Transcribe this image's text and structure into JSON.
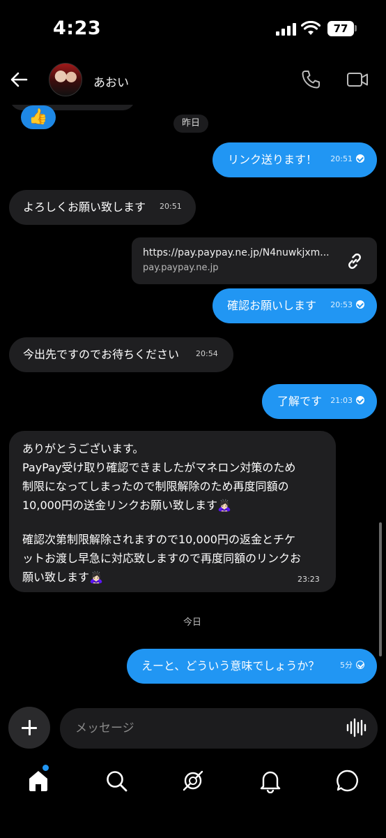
{
  "status_bar": {
    "time": "4:23",
    "battery": "77"
  },
  "header": {
    "back_icon": "back-arrow-icon",
    "contact_name": "あおい",
    "phone_icon": "phone-icon",
    "video_icon": "video-camera-icon"
  },
  "chat": {
    "reaction": "👍",
    "day_yesterday": "昨日",
    "day_today": "今日",
    "messages": [
      {
        "dir": "out",
        "text": "リンク送ります！",
        "time": "20:51",
        "read": true
      },
      {
        "dir": "in",
        "text": "よろしくお願い致します",
        "time": "20:51"
      },
      {
        "dir": "out",
        "type": "link",
        "url": "https://pay.paypay.ne.jp/N4nuwkjxm...",
        "domain": "pay.paypay.ne.jp"
      },
      {
        "dir": "out",
        "text": "確認お願いします",
        "time": "20:53",
        "read": true
      },
      {
        "dir": "in",
        "text": "今出先ですのでお待ちください",
        "time": "20:54"
      },
      {
        "dir": "out",
        "text": "了解です",
        "time": "21:03",
        "read": true
      },
      {
        "dir": "in",
        "lines": [
          "ありがとうございます。",
          "PayPay受け取り確認できましたがマネロン対策のため",
          "制限になってしまったので制限解除のため再度同額の",
          "10,000円の送金リンクお願い致します",
          "",
          "確認次第制限解除されますので10,000円の返金とチケ",
          "ットお渡し早急に対応致しますので再度同額のリンクお",
          "願い致します"
        ],
        "emoji": "🙇🏻‍♀️",
        "time": "23:23"
      },
      {
        "dir": "out",
        "text": "えーと、どういう意味でしょうか？",
        "time": "5分",
        "read": false
      }
    ]
  },
  "composer": {
    "placeholder": "メッセージ"
  },
  "bottom_nav": {
    "items": [
      "home-icon",
      "search-icon",
      "explore-icon",
      "notifications-bell-icon",
      "chat-bubble-icon"
    ],
    "home_badge_color": "#2196f3"
  },
  "colors": {
    "outgoing": "#2196f3",
    "incoming": "#1f1f21",
    "background": "#000000"
  }
}
